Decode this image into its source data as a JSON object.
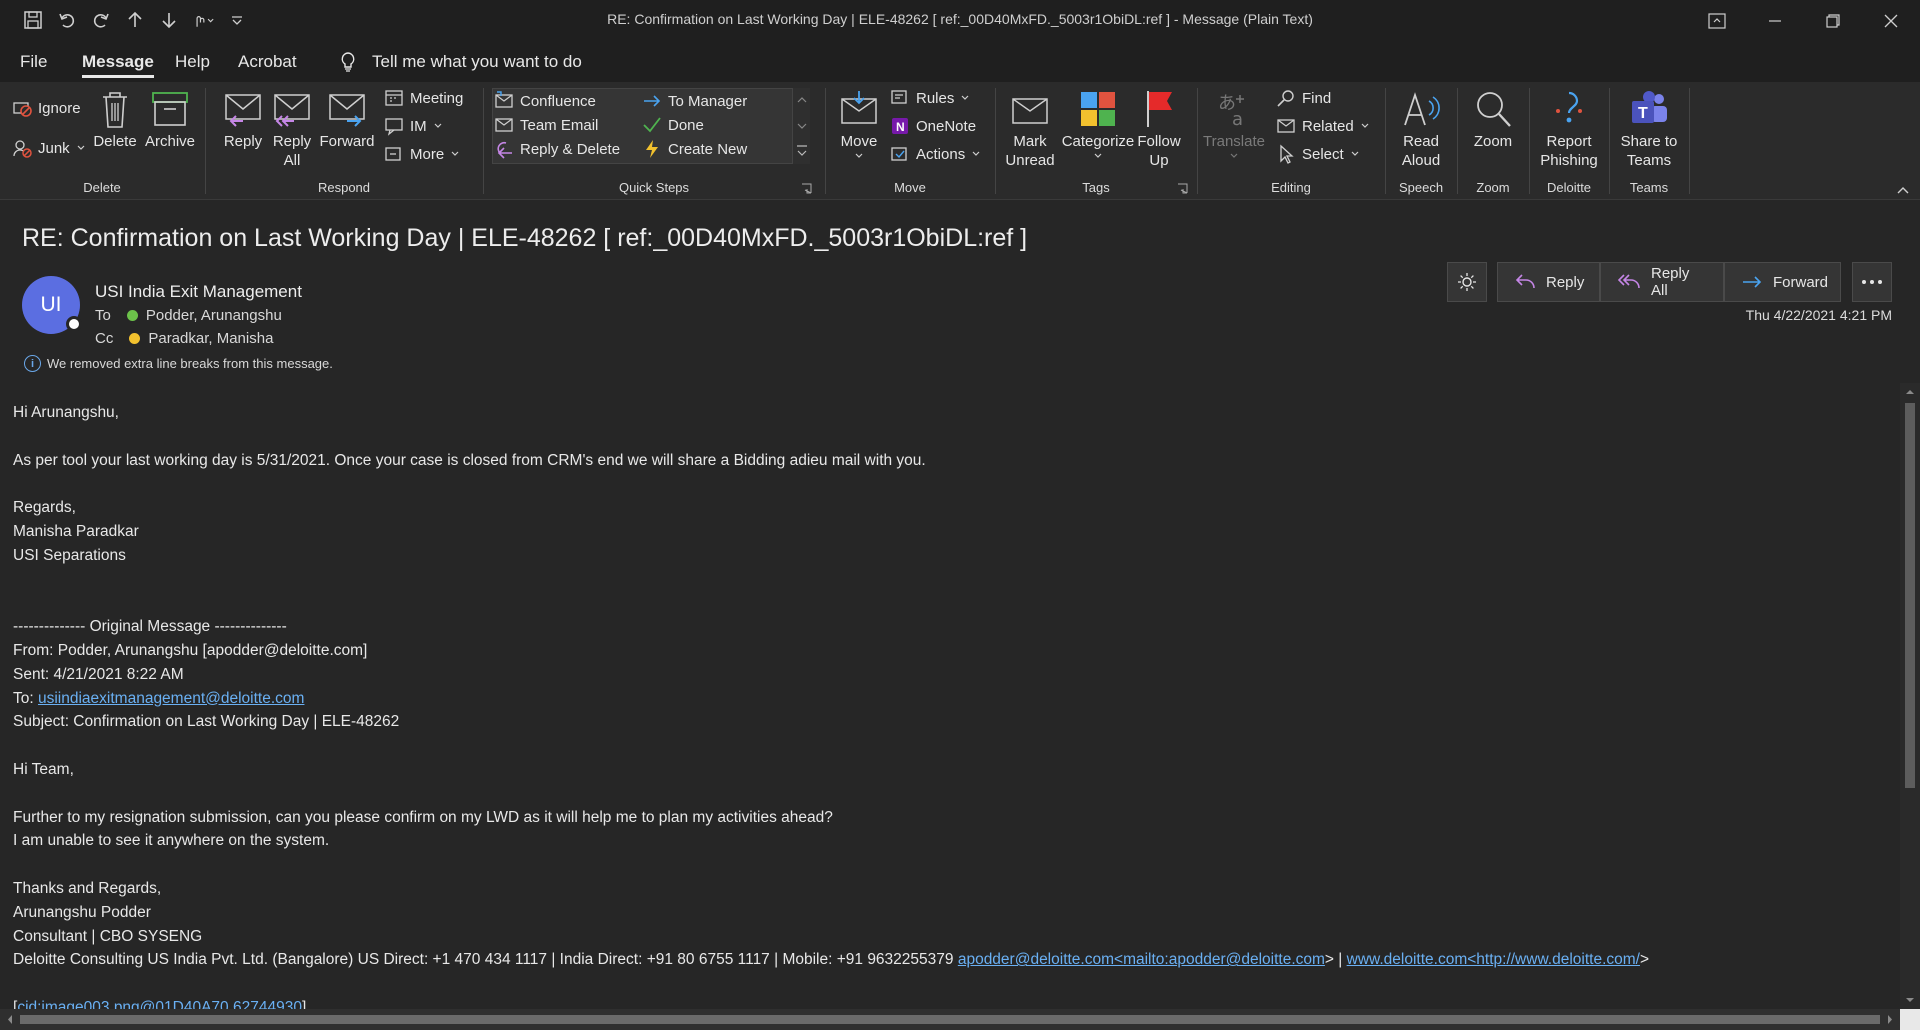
{
  "window": {
    "title": "RE: Confirmation on Last Working Day | ELE-48262    [ ref:_00D40MxFD._5003r1ObiDL:ref ]  -  Message (Plain Text)"
  },
  "menu": {
    "tabs": [
      "File",
      "Message",
      "Help",
      "Acrobat"
    ],
    "active_tab": "Message",
    "tell_me": "Tell me what you want to do"
  },
  "ribbon": {
    "delete": {
      "label": "Delete",
      "ignore": "Ignore",
      "junk": "Junk",
      "delete": "Delete",
      "archive": "Archive"
    },
    "respond": {
      "label": "Respond",
      "reply": "Reply",
      "reply_all": "Reply All",
      "forward": "Forward",
      "meeting": "Meeting",
      "im": "IM",
      "more": "More"
    },
    "quick_steps": {
      "label": "Quick Steps",
      "items": [
        "Confluence",
        "To Manager",
        "Team Email",
        "Done",
        "Reply & Delete",
        "Create New"
      ]
    },
    "move": {
      "label": "Move",
      "move": "Move",
      "rules": "Rules",
      "onenote": "OneNote",
      "actions": "Actions"
    },
    "tags": {
      "label": "Tags",
      "mark_unread": "Mark Unread",
      "categorize": "Categorize",
      "follow_up": "Follow Up"
    },
    "editing": {
      "label": "Editing",
      "translate": "Translate",
      "find": "Find",
      "related": "Related",
      "select": "Select"
    },
    "speech": {
      "label": "Speech",
      "read_aloud": "Read Aloud"
    },
    "zoom": {
      "label": "Zoom",
      "zoom": "Zoom"
    },
    "deloitte": {
      "label": "Deloitte",
      "report_phishing": "Report Phishing"
    },
    "teams": {
      "label": "Teams",
      "share": "Share to Teams"
    }
  },
  "message": {
    "subject": "RE: Confirmation on Last Working Day | ELE-48262    [ ref:_00D40MxFD._5003r1ObiDL:ref ]",
    "avatar_initials": "UI",
    "sender": "USI India Exit Management",
    "to_label": "To",
    "to": "Podder, Arunangshu",
    "cc_label": "Cc",
    "cc": "Paradkar, Manisha",
    "info": "We removed extra line breaks from this message.",
    "date": "Thu 4/22/2021 4:21 PM",
    "actions": {
      "reply": "Reply",
      "reply_all": "Reply All",
      "forward": "Forward"
    }
  },
  "body": {
    "greeting": "Hi Arunangshu,",
    "p1": "As per tool your last working day is 5/31/2021. Once your case is closed from CRM's end we will share a Bidding adieu mail with you.",
    "regards": "Regards,",
    "sign_name": "Manisha Paradkar",
    "sign_team": "USI Separations",
    "orig_header": "-------------- Original Message --------------",
    "from": "From: Podder, Arunangshu [apodder@deloitte.com]",
    "sent": "Sent: 4/21/2021 8:22 AM",
    "to_prefix": "To: ",
    "to_link": "usiindiaexitmanagement@deloitte.com",
    "subject_line": "Subject: Confirmation on Last Working Day | ELE-48262",
    "hi_team": "Hi Team,",
    "q1": "Further to my resignation submission, can you please confirm on my LWD as it will help me to plan my activities ahead?",
    "q2": "I am unable to see it anywhere on the system.",
    "thanks": "Thanks and Regards,",
    "name2": "Arunangshu Podder",
    "role": "Consultant | CBO SYSENG",
    "contact": "Deloitte Consulting US India Pvt. Ltd. (Bangalore) US Direct: +1 470 434 1117 | India Direct: +91 80 6755 1117 | Mobile: +91 9632255379 ",
    "mail_link": "apodder@deloitte.com<mailto:apodder@deloitte.com",
    "between": "> | ",
    "web_link": "www.deloitte.com<http://www.deloitte.com/",
    "end": ">",
    "cid_open": "[",
    "cid_link": "cid:image003.png@01D40A70.62744930",
    "cid_close": "]"
  },
  "colors": {
    "background": "#262626",
    "ribbon": "#2b2b2b",
    "titlebar": "#1f1f1f",
    "accent_blue": "#5b6ee1",
    "link": "#6ab0f3",
    "presence_green": "#6cc24a",
    "presence_yellow": "#f2c12e"
  }
}
